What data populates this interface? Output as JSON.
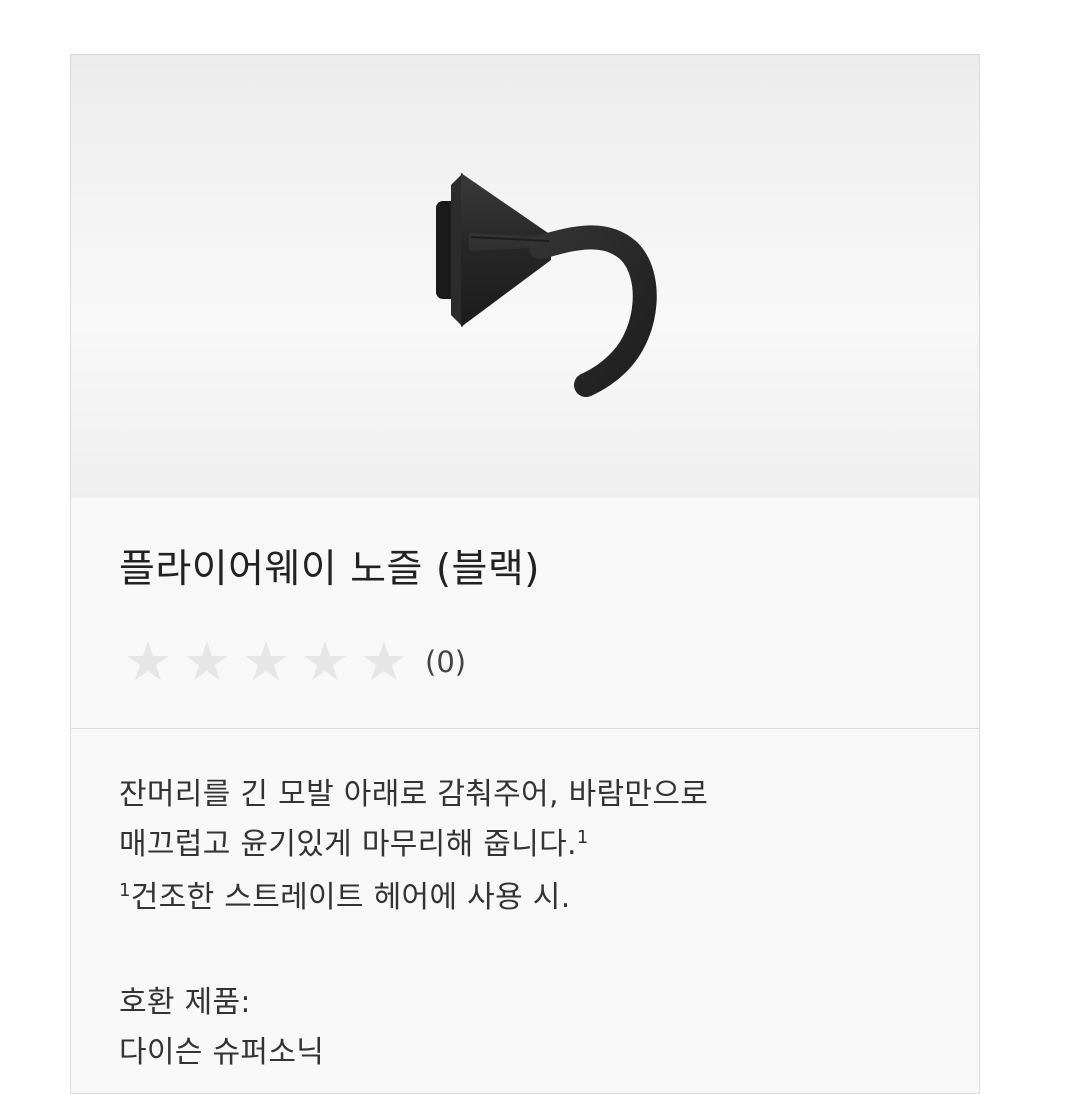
{
  "product": {
    "image_alt": "플라이어웨이 노즐 (블랙)",
    "title": "플라이어웨이 노즐 (블랙)",
    "rating": {
      "stars_total": 5,
      "stars_filled": 0,
      "count_label": "(0)"
    },
    "description": {
      "line1": "잔머리를 긴 모발 아래로 감춰주어, 바람만으로",
      "line2": "매끄럽고 윤기있게 마무리해 줍니다.",
      "line2_footnote": "1",
      "footnote_marker": "1",
      "footnote_text": "건조한 스트레이트 헤어에 사용 시."
    },
    "compatibility": {
      "label": "호환 제품:",
      "value": "다이슨 슈퍼소닉"
    }
  },
  "colors": {
    "star_empty": "#e6e6e6",
    "nozzle": "#2a2a2a"
  }
}
